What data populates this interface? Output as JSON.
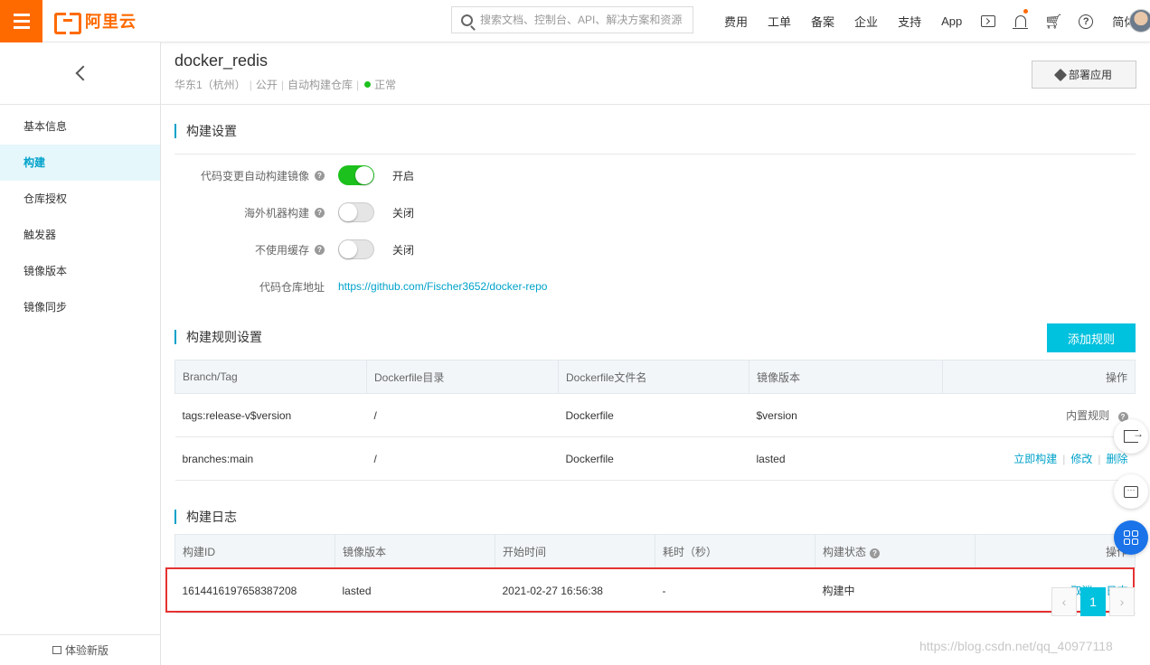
{
  "header": {
    "brand": "阿里云",
    "search_placeholder": "搜索文档、控制台、API、解决方案和资源",
    "nav": [
      "费用",
      "工单",
      "备案",
      "企业",
      "支持",
      "App"
    ],
    "language": "简体",
    "icons": [
      "terminal-icon",
      "bell-icon",
      "cart-icon",
      "help-icon"
    ]
  },
  "sidebar": {
    "items": [
      {
        "label": "基本信息",
        "active": false
      },
      {
        "label": "构建",
        "active": true
      },
      {
        "label": "仓库授权",
        "active": false
      },
      {
        "label": "触发器",
        "active": false
      },
      {
        "label": "镜像版本",
        "active": false
      },
      {
        "label": "镜像同步",
        "active": false
      }
    ],
    "footer": "体验新版"
  },
  "page": {
    "title": "docker_redis",
    "region": "华东1（杭州）",
    "visibility": "公开",
    "type": "自动构建仓库",
    "status": "正常",
    "deploy_label": "部署应用"
  },
  "build_settings": {
    "title": "构建设置",
    "rows": [
      {
        "label": "代码变更自动构建镜像",
        "state": "开启",
        "on": true
      },
      {
        "label": "海外机器构建",
        "state": "关闭",
        "on": false
      },
      {
        "label": "不使用缓存",
        "state": "关闭",
        "on": false
      }
    ],
    "repo_label": "代码仓库地址",
    "repo_url": "https://github.com/Fischer3652/docker-repo"
  },
  "build_rules": {
    "title": "构建规则设置",
    "add_label": "添加规则",
    "columns": [
      "Branch/Tag",
      "Dockerfile目录",
      "Dockerfile文件名",
      "镜像版本",
      "操作"
    ],
    "rows": [
      {
        "branch": "tags:release-v$version",
        "dir": "/",
        "file": "Dockerfile",
        "version": "$version",
        "ops": [
          "内置规则"
        ]
      },
      {
        "branch": "branches:main",
        "dir": "/",
        "file": "Dockerfile",
        "version": "lasted",
        "ops": [
          "立即构建",
          "修改",
          "删除"
        ]
      }
    ]
  },
  "build_log": {
    "title": "构建日志",
    "columns": [
      "构建ID",
      "镜像版本",
      "开始时间",
      "耗时（秒）",
      "构建状态",
      "操作"
    ],
    "rows": [
      {
        "id": "1614416197658387208",
        "version": "lasted",
        "start": "2021-02-27 16:56:38",
        "duration": "-",
        "status": "构建中",
        "ops": [
          "取消",
          "日志"
        ]
      }
    ]
  },
  "pagination": {
    "current": "1"
  },
  "watermark": "https://blog.csdn.net/qq_40977118",
  "colors": {
    "brand": "#ff6a00",
    "accent": "#00c1de",
    "link": "#00a2ca",
    "switch_on": "#1dc11d",
    "highlight": "#e53232"
  }
}
